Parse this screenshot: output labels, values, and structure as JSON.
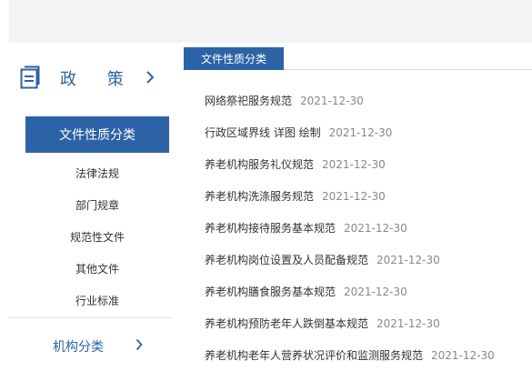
{
  "sidebar": {
    "section_title": "政 策",
    "active_category": "文件性质分类",
    "sub_items": [
      {
        "label": "法律法规"
      },
      {
        "label": "部门规章"
      },
      {
        "label": "规范性文件"
      },
      {
        "label": "其他文件"
      },
      {
        "label": "行业标准"
      }
    ],
    "org_category": "机构分类"
  },
  "main": {
    "tab_label": "文件性质分类",
    "documents": [
      {
        "title": "网络祭祀服务规范",
        "date": "2021-12-30"
      },
      {
        "title": "行政区域界线 详图 绘制",
        "date": "2021-12-30"
      },
      {
        "title": "养老机构服务礼仪规范",
        "date": "2021-12-30"
      },
      {
        "title": "养老机构洗涤服务规范",
        "date": "2021-12-30"
      },
      {
        "title": "养老机构接待服务基本规范",
        "date": "2021-12-30"
      },
      {
        "title": "养老机构岗位设置及人员配备规范",
        "date": "2021-12-30"
      },
      {
        "title": "养老机构膳食服务基本规范",
        "date": "2021-12-30"
      },
      {
        "title": "养老机构预防老年人跌倒基本规范",
        "date": "2021-12-30"
      },
      {
        "title": "养老机构老年人营养状况评价和监测服务规范",
        "date": "2021-12-30"
      }
    ]
  },
  "colors": {
    "accent": "#2c63a6",
    "top_bar": "#f3f3f3",
    "date_text": "#888888"
  },
  "icons": {
    "policy": "document-icon",
    "expand": "chevron-right-icon"
  }
}
